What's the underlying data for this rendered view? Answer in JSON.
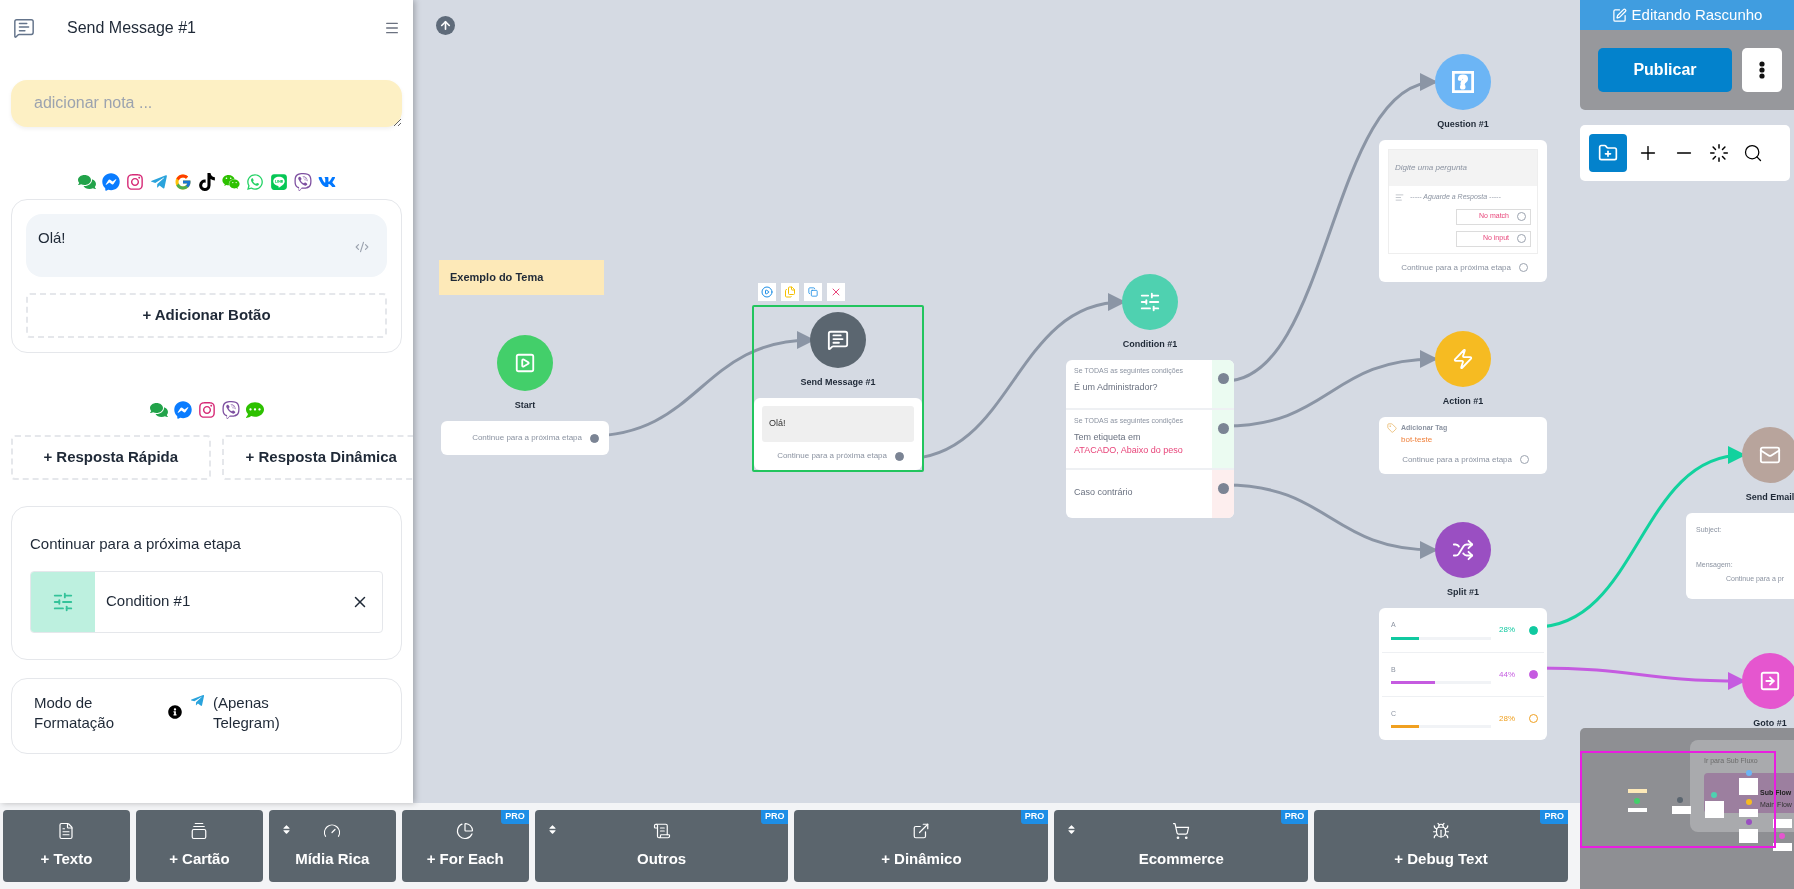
{
  "sidebar": {
    "title": "Send Message #1",
    "note": {
      "placeholder": "adicionar nota ..."
    },
    "message": {
      "value": "Olá!"
    },
    "add_button": "+ Adicionar Botão",
    "reply_buttons": [
      "+ Resposta Rápida",
      "+ Resposta Dinâmica"
    ],
    "next_step": {
      "label": "Continuar para a próxima etapa",
      "target": "Condition #1"
    },
    "formatting": {
      "label": "Modo de Formatação",
      "hint": "(Apenas Telegram)"
    }
  },
  "canvas": {
    "note": "Exemplo do Tema",
    "nodes": [
      {
        "kind": "start",
        "title": "Start",
        "color": "#43cf6a",
        "selected": false,
        "next": {
          "label": "Continue para a próxima etapa",
          "connected": true
        }
      },
      {
        "kind": "message",
        "title": "Send Message #1",
        "color": "#5b6670",
        "selected": true,
        "text": "Olá!",
        "next": {
          "label": "Continue para a próxima etapa",
          "connected": true
        }
      },
      {
        "kind": "condition",
        "title": "Condition #1",
        "color": "#4fd1b0",
        "selected": false,
        "rows": [
          {
            "kind": "rule",
            "caption": "Se TODAS as seguintes condições",
            "text": "É um Administrador?"
          },
          {
            "kind": "rule",
            "caption": "Se TODAS as seguintes condições",
            "text": "Tem etiqueta em",
            "tags": "ATACADO, Abaixo do peso"
          },
          {
            "kind": "else",
            "text": "Caso contrário"
          }
        ]
      },
      {
        "kind": "question",
        "title": "Question #1",
        "color": "#6cb5f5",
        "selected": false,
        "placeholder": "Digite uma pergunta",
        "wait": "----- Aguarde a Resposta -----",
        "fallbacks": [
          {
            "label": "No match",
            "connected": false
          },
          {
            "label": "No input",
            "connected": false
          }
        ],
        "next": {
          "label": "Continue para a próxima etapa",
          "connected": false
        }
      },
      {
        "kind": "action",
        "title": "Action #1",
        "color": "#f6bb22",
        "selected": false,
        "action": "Adicionar Tag",
        "tag": "bot-teste",
        "next": {
          "label": "Continue para a próxima etapa",
          "connected": false
        }
      },
      {
        "kind": "split",
        "title": "Split #1",
        "color": "#9a4fc2",
        "selected": false,
        "branches": [
          {
            "label": "A",
            "percent": "28%",
            "level": 0.28,
            "color": "#10c9a0",
            "connected": true
          },
          {
            "label": "B",
            "percent": "44%",
            "level": 0.44,
            "color": "#c55be0",
            "connected": true
          },
          {
            "label": "C",
            "percent": "28%",
            "level": 0.28,
            "color": "#f0a020",
            "connected": false
          }
        ]
      },
      {
        "kind": "email",
        "title": "Send Email",
        "color": "#b8a49c",
        "selected": false,
        "fields": [
          "Subject:",
          "Mensagem:"
        ],
        "next": {
          "label": "Continue para a pr"
        }
      },
      {
        "kind": "goto",
        "title": "Goto #1",
        "color": "#e556cf",
        "selected": false
      }
    ]
  },
  "toolbar": [
    {
      "kind": "text",
      "label": "+ Texto"
    },
    {
      "kind": "card",
      "label": "+ Cartão"
    },
    {
      "kind": "media",
      "label": "Mídia Rica",
      "sortable": true
    },
    {
      "kind": "foreach",
      "label": "+ For Each",
      "badge": "PRO"
    },
    {
      "kind": "other",
      "label": "Outros",
      "sortable": true,
      "badge": "PRO"
    },
    {
      "kind": "dynamic",
      "label": "+ Dinâmico",
      "badge": "PRO"
    },
    {
      "kind": "ecommerce",
      "label": "Ecommerce",
      "sortable": true,
      "badge": "PRO"
    },
    {
      "kind": "debug",
      "label": "+ Debug Text",
      "badge": "PRO"
    }
  ],
  "status": "Editando Rascunho",
  "publish": "Publicar",
  "minimap": {
    "labels": [
      "Ir para Sub Fluxo",
      "Sub Flow",
      "Main Flow"
    ]
  }
}
